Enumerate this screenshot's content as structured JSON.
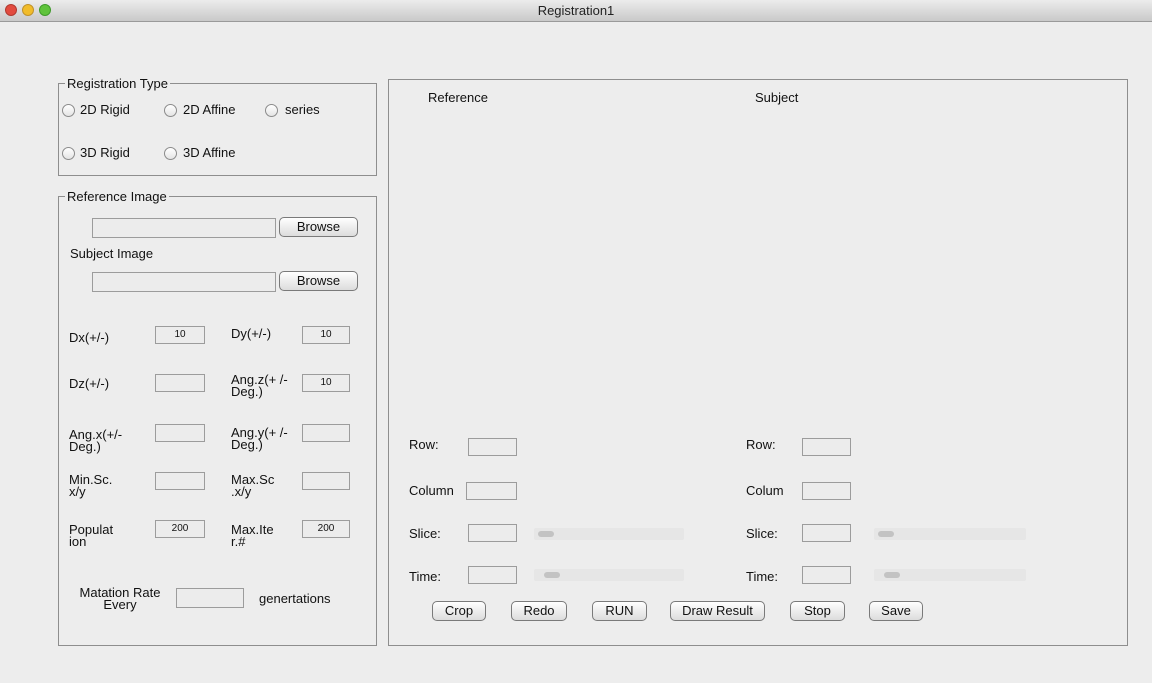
{
  "window": {
    "title": "Registration1"
  },
  "registration_type": {
    "legend": "Registration Type",
    "options": [
      {
        "label": "2D Rigid"
      },
      {
        "label": "2D Affine"
      },
      {
        "label": "series"
      },
      {
        "label": "3D Rigid"
      },
      {
        "label": "3D Affine"
      }
    ]
  },
  "images": {
    "legend": "Reference Image",
    "subject_label": "Subject Image",
    "browse_label": "Browse",
    "reference_path": "",
    "subject_path": ""
  },
  "params": {
    "dx_label": "Dx(+/-)",
    "dx_value": "10",
    "dy_label": "Dy(+/-)",
    "dy_value": "10",
    "dz_label": "Dz(+/-)",
    "dz_value": "",
    "angz_label": "Ang.z(+ /- Deg.)",
    "angz_value": "10",
    "angx_label": "Ang.x(+/- Deg.)",
    "angx_value": "",
    "angy_label": "Ang.y(+ /- Deg.)",
    "angy_value": "",
    "minsc_label": "Min.Sc. x/y",
    "minsc_value": "",
    "maxsc_label": "Max.Sc .x/y",
    "maxsc_value": "",
    "pop_label": "Populat ion",
    "pop_value": "200",
    "maxiter_label": "Max.Ite r.#",
    "maxiter_value": "200",
    "mutation_label": "Matation Rate Every",
    "mutation_value": "",
    "generations_label": "genertations"
  },
  "viewer": {
    "reference_title": "Reference",
    "subject_title": "Subject",
    "reference": {
      "row_label": "Row:",
      "row_value": "",
      "column_label": "Column",
      "column_value": "",
      "slice_label": "Slice:",
      "slice_value": "",
      "slice_slider": 0.0,
      "time_label": "Time:",
      "time_value": "",
      "time_slider": 0.05
    },
    "subject": {
      "row_label": "Row:",
      "row_value": "",
      "column_label": "Colum",
      "column_value": "",
      "slice_label": "Slice:",
      "slice_value": "",
      "slice_slider": 0.0,
      "time_label": "Time:",
      "time_value": "",
      "time_slider": 0.05
    }
  },
  "actions": {
    "crop": "Crop",
    "redo": "Redo",
    "run": "RUN",
    "draw_result": "Draw Result",
    "stop": "Stop",
    "save": "Save"
  }
}
